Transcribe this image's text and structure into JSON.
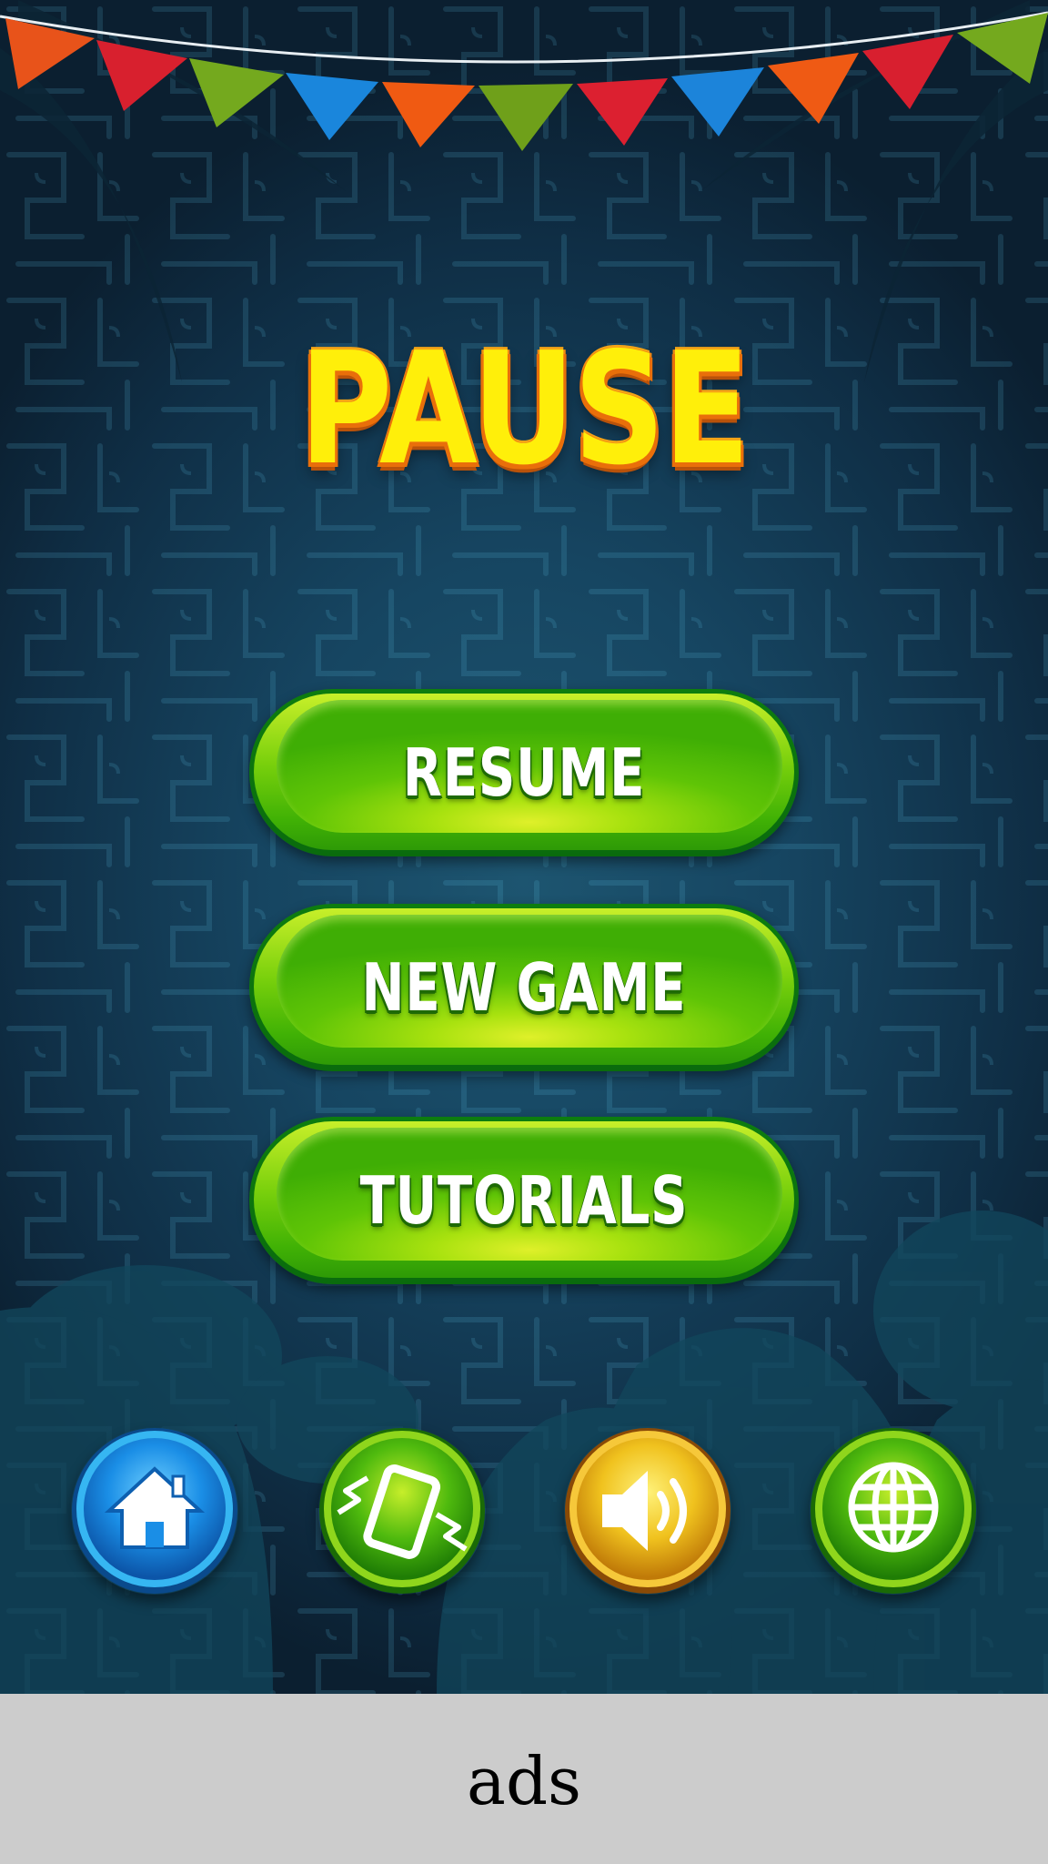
{
  "screen": {
    "title": "PAUSE"
  },
  "menu": {
    "buttons": [
      {
        "label": "RESUME"
      },
      {
        "label": "NEW GAME"
      },
      {
        "label": "TUTORIALS"
      }
    ]
  },
  "toolbar": {
    "buttons": [
      {
        "icon": "home-icon",
        "color": "#1a8ee6"
      },
      {
        "icon": "vibration-icon",
        "color": "#4fba0e"
      },
      {
        "icon": "sound-icon",
        "color": "#f0c21e"
      },
      {
        "icon": "globe-icon",
        "color": "#4fba0e"
      }
    ]
  },
  "ad_banner": {
    "text": "ads"
  },
  "colors": {
    "background": "#164561",
    "title_fill": "#ffef0a",
    "title_outline": "#e96f0a",
    "button_green": "#5fc406",
    "ad_bar": "#cccccc"
  }
}
